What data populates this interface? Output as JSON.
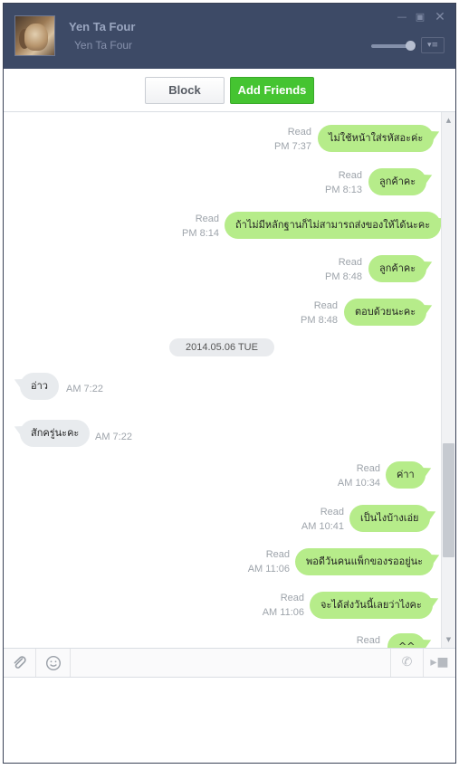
{
  "header": {
    "name": "Yen Ta Four",
    "subtitle": "Yen Ta Four",
    "minimize_icon": "minimize-icon",
    "maximize_icon": "maximize-icon",
    "close_icon": "close-icon",
    "volume_level": 0.85
  },
  "actions": {
    "block_label": "Block",
    "add_friends_label": "Add Friends",
    "add_color": "#45c431"
  },
  "date_separator": "2014.05.06 TUE",
  "messages": [
    {
      "dir": "out",
      "text": "ไม่ใช้หน้าใส่รหัสอะค่ะ",
      "status": "Read",
      "time": "PM 7:37"
    },
    {
      "dir": "out",
      "text": "ลูกค้าคะ",
      "status": "Read",
      "time": "PM 8:13"
    },
    {
      "dir": "out",
      "text": "ถ้าไม่มีหลักฐานก็ไม่สามารถส่งของให้ได้นะคะ",
      "status": "Read",
      "time": "PM 8:14"
    },
    {
      "dir": "out",
      "text": "ลูกค้าคะ",
      "status": "Read",
      "time": "PM 8:48"
    },
    {
      "dir": "out",
      "text": "ตอบด้วยนะคะ",
      "status": "Read",
      "time": "PM 8:48"
    },
    {
      "dir": "in",
      "text": "อ่าว",
      "time": "AM 7:22"
    },
    {
      "dir": "in",
      "text": "สักครู่นะคะ",
      "time": "AM 7:22"
    },
    {
      "dir": "out",
      "text": "ค่าา",
      "status": "Read",
      "time": "AM 10:34"
    },
    {
      "dir": "out",
      "text": "เป็นไงบ้างเอ่ย",
      "status": "Read",
      "time": "AM 10:41"
    },
    {
      "dir": "out",
      "text": "พอดีวันคนแพ็กของรออยู่นะ",
      "status": "Read",
      "time": "AM 11:06"
    },
    {
      "dir": "out",
      "text": "จะได้ส่งวันนี้เลยว่าไงคะ",
      "status": "Read",
      "time": "AM 11:06"
    },
    {
      "dir": "out",
      "text": "^^",
      "status": "Read",
      "time": ""
    }
  ],
  "toolbar": {
    "attach_icon": "paperclip-icon",
    "emoji_icon": "smiley-icon",
    "call_icon": "phone-icon",
    "video_icon": "video-icon"
  },
  "colors": {
    "header_bg": "#3d4a66",
    "outgoing_bubble": "#b6ec8a",
    "incoming_bubble": "#e8ebee"
  }
}
